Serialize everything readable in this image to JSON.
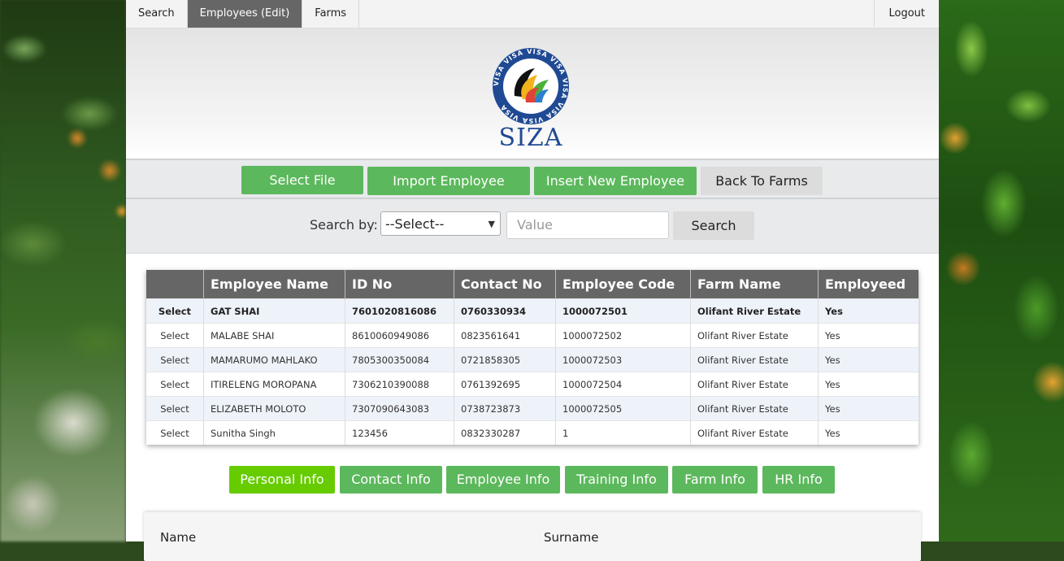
{
  "topnav": {
    "items": [
      "Search",
      "Employees (Edit)",
      "Farms"
    ],
    "active": "Employees (Edit)",
    "logout": "Logout"
  },
  "logo": {
    "ring_text": "VISA",
    "brand": "SIZA",
    "ring_color": "#1f4a93"
  },
  "actions": {
    "select_file": "Select File",
    "import_employee": "Import Employee",
    "insert_new_employee": "Insert New Employee",
    "back_to_farms": "Back To Farms"
  },
  "search": {
    "label": "Search by:",
    "select_value": "--Select--",
    "value_placeholder": "Value",
    "button": "Search"
  },
  "table": {
    "headers": [
      "",
      "Employee Name",
      "ID No",
      "Contact No",
      "Employee Code",
      "Farm Name",
      "Employeed"
    ],
    "rows": [
      {
        "action": "Select",
        "name": "GAT SHAI",
        "id_no": "7601020816086",
        "contact": "0760330934",
        "code": "1000072501",
        "farm": "Olifant River Estate",
        "employed": "Yes"
      },
      {
        "action": "Select",
        "name": "MALABE SHAI",
        "id_no": "8610060949086",
        "contact": "0823561641",
        "code": "1000072502",
        "farm": "Olifant River Estate",
        "employed": "Yes"
      },
      {
        "action": "Select",
        "name": "MAMARUMO MAHLAKO",
        "id_no": "7805300350084",
        "contact": "0721858305",
        "code": "1000072503",
        "farm": "Olifant River Estate",
        "employed": "Yes"
      },
      {
        "action": "Select",
        "name": "ITIRELENG MOROPANA",
        "id_no": "7306210390088",
        "contact": "0761392695",
        "code": "1000072504",
        "farm": "Olifant River Estate",
        "employed": "Yes"
      },
      {
        "action": "Select",
        "name": "ELIZABETH MOLOTO",
        "id_no": "7307090643083",
        "contact": "0738723873",
        "code": "1000072505",
        "farm": "Olifant River Estate",
        "employed": "Yes"
      },
      {
        "action": "Select",
        "name": "Sunitha Singh",
        "id_no": "123456",
        "contact": "0832330287",
        "code": "1",
        "farm": "Olifant River Estate",
        "employed": "Yes"
      }
    ]
  },
  "tabs": {
    "items": [
      "Personal Info",
      "Contact Info",
      "Employee Info",
      "Training Info",
      "Farm Info",
      "HR Info"
    ],
    "active": "Personal Info"
  },
  "form": {
    "name_label": "Name",
    "surname_label": "Surname"
  },
  "colors": {
    "green_button": "#5cb85c",
    "active_tab": "#66cc00",
    "table_header": "#666666",
    "nav_active": "#666666"
  }
}
